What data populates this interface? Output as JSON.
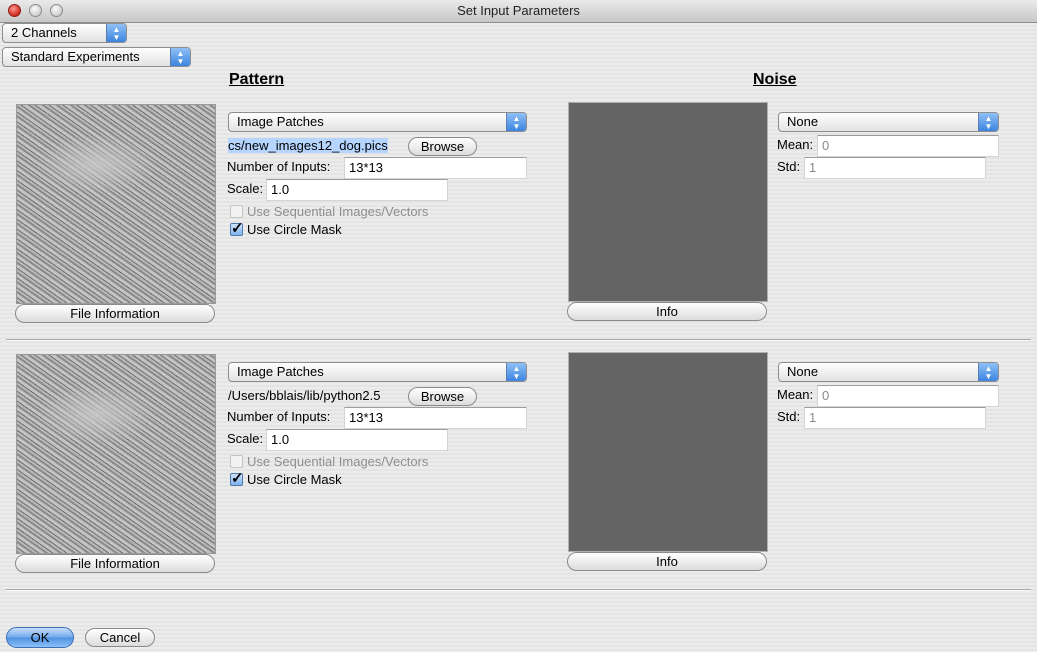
{
  "window": {
    "title": "Set Input Parameters"
  },
  "controls": {
    "channels_select": "2 Channels",
    "experiments_select": "Standard Experiments"
  },
  "headings": {
    "pattern": "Pattern",
    "noise": "Noise"
  },
  "channels": [
    {
      "pattern_type": "Image Patches",
      "file_path": "cs/new_images12_dog.pics",
      "file_path_selected": true,
      "browse_label": "Browse",
      "num_inputs_label": "Number of Inputs:",
      "num_inputs_value": "13*13",
      "scale_label": "Scale:",
      "scale_value": "1.0",
      "sequential_label": "Use Sequential Images/Vectors",
      "sequential_checked": false,
      "sequential_enabled": false,
      "circle_mask_label": "Use Circle Mask",
      "circle_mask_checked": true,
      "file_info_label": "File Information",
      "noise_type": "None",
      "mean_label": "Mean:",
      "mean_value": "0",
      "std_label": "Std:",
      "std_value": "1",
      "info_label": "Info"
    },
    {
      "pattern_type": "Image Patches",
      "file_path": "/Users/bblais/lib/python2.5",
      "file_path_selected": false,
      "browse_label": "Browse",
      "num_inputs_label": "Number of Inputs:",
      "num_inputs_value": "13*13",
      "scale_label": "Scale:",
      "scale_value": "1.0",
      "sequential_label": "Use Sequential Images/Vectors",
      "sequential_checked": false,
      "sequential_enabled": false,
      "circle_mask_label": "Use Circle Mask",
      "circle_mask_checked": true,
      "file_info_label": "File Information",
      "noise_type": "None",
      "mean_label": "Mean:",
      "mean_value": "0",
      "std_label": "Std:",
      "std_value": "1",
      "info_label": "Info"
    }
  ],
  "footer": {
    "ok_label": "OK",
    "cancel_label": "Cancel"
  }
}
